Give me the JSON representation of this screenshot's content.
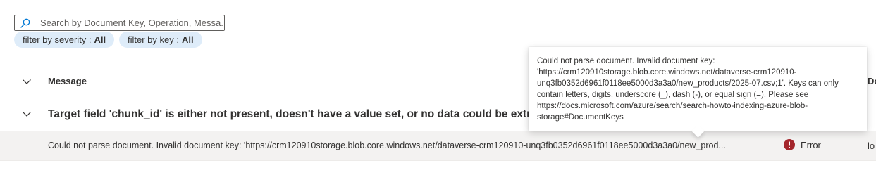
{
  "search": {
    "placeholder": "Search by Document Key, Operation, Messa..."
  },
  "filters": [
    {
      "label": "filter by severity :",
      "value": "All"
    },
    {
      "label": "filter by key :",
      "value": "All"
    }
  ],
  "table": {
    "columns": {
      "message": "Message",
      "document": "Do"
    },
    "group": {
      "title": "Target field 'chunk_id' is either not present, doesn't have a value set, or no data could be extra"
    },
    "rows": [
      {
        "message": "Could not parse document. Invalid document key: 'https://crm120910storage.blob.core.windows.net/dataverse-crm120910-unq3fb0352d6961f0118ee5000d3a3a0/new_prod...",
        "severity": "Error",
        "location": "lo"
      }
    ]
  },
  "tooltip": {
    "lines": [
      "Could not parse document. Invalid document key:",
      "'https://crm120910storage.blob.core.windows.net/dataverse-crm120910-",
      "unq3fb0352d6961f0118ee5000d3a3a0/new_products/2025-07.csv;1'. Keys can only",
      "contain letters, digits, underscore (_), dash (-), or equal sign (=). Please see",
      "https://docs.microsoft.com/azure/search/search-howto-indexing-azure-blob-",
      "storage#DocumentKeys"
    ]
  },
  "colors": {
    "accent": "#0078d4",
    "pill_bg": "#deecf9",
    "row_highlight": "#f3f2f1",
    "error": "#a4262c"
  },
  "icons": {
    "search": "search-icon",
    "expand": "chevron-down-icon",
    "error": "error-icon"
  }
}
